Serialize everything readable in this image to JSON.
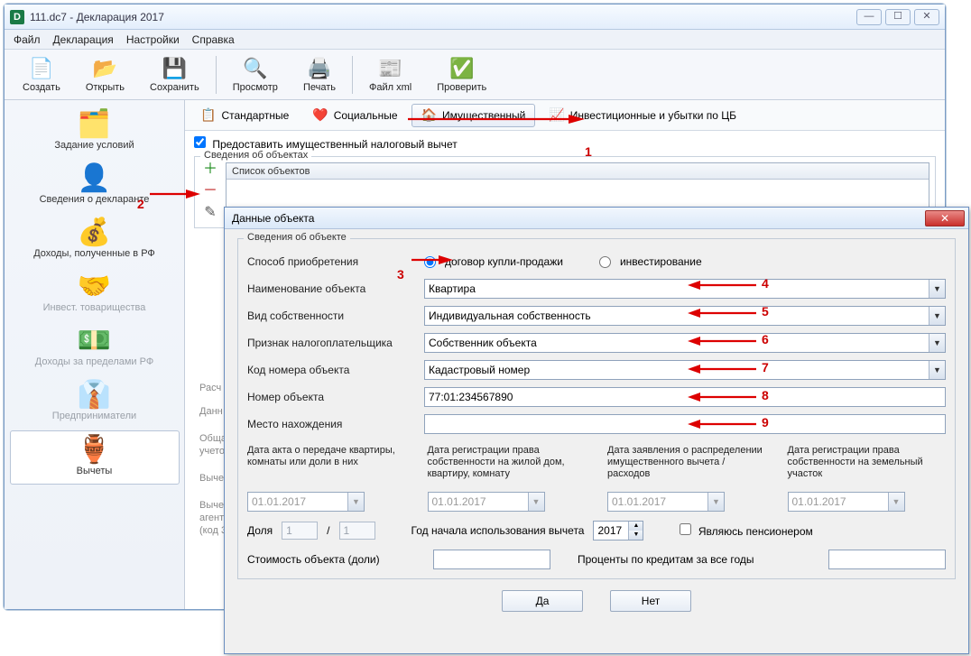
{
  "window": {
    "title": "111.dc7 - Декларация 2017"
  },
  "menu": [
    "Файл",
    "Декларация",
    "Настройки",
    "Справка"
  ],
  "toolbar": [
    {
      "icon": "📄",
      "label": "Создать"
    },
    {
      "icon": "📂",
      "label": "Открыть"
    },
    {
      "icon": "💾",
      "label": "Сохранить"
    },
    {
      "sep": true
    },
    {
      "icon": "🔍",
      "label": "Просмотр"
    },
    {
      "icon": "🖨️",
      "label": "Печать"
    },
    {
      "sep": true
    },
    {
      "icon": "📰",
      "label": "Файл xml"
    },
    {
      "icon": "✅",
      "label": "Проверить"
    }
  ],
  "sidebar": [
    {
      "icon": "🗂️",
      "label": "Задание условий",
      "state": ""
    },
    {
      "icon": "👤",
      "label": "Сведения о декларанте",
      "state": ""
    },
    {
      "icon": "💰",
      "label": "Доходы, полученные в РФ",
      "state": ""
    },
    {
      "icon": "🤝",
      "label": "Инвест. товарищества",
      "state": "disabled"
    },
    {
      "icon": "💵",
      "label": "Доходы за пределами РФ",
      "state": "disabled"
    },
    {
      "icon": "👔",
      "label": "Предприниматели",
      "state": "disabled"
    },
    {
      "icon": "🏺",
      "label": "Вычеты",
      "state": "sel"
    }
  ],
  "dedtabs": [
    {
      "icon": "📋",
      "label": "Стандартные",
      "sel": false
    },
    {
      "icon": "❤️",
      "label": "Социальные",
      "sel": false
    },
    {
      "icon": "🏠",
      "label": "Имущественный",
      "sel": true
    },
    {
      "icon": "📈",
      "label": "Инвестиционные и убытки по ЦБ",
      "sel": false
    }
  ],
  "grant_checkbox": "Предоставить имущественный налоговый вычет",
  "objects_fieldset": "Сведения об объектах",
  "objects_header": "Список объектов",
  "calc_title": "Расчет имущественного вычета",
  "calc_sub1": "Данные по покупке (строительству) объектов",
  "calc_line1a": "Общая стоимость всех объектов (с учетом ограничений вычета)",
  "calc_line2a": "Вычет по предыдущим годам",
  "calc_line3a": "Вычет у налогового агента в отчетном году",
  "faded": {
    "a": "Расч",
    "b": "Данн",
    "c": "Обща\nучето",
    "d": "Выче",
    "e": "Выче\nагент\n(код 3"
  },
  "dialog": {
    "title": "Данные объекта",
    "fieldset": "Сведения об объекте",
    "acq_label": "Способ приобретения",
    "acq_opt1": "договор купли-продажи",
    "acq_opt2": "инвестирование",
    "name_label": "Наименование объекта",
    "name_value": "Квартира",
    "own_label": "Вид собственности",
    "own_value": "Индивидуальная собственность",
    "taxp_label": "Признак налогоплательщика",
    "taxp_value": "Собственник объекта",
    "code_label": "Код номера объекта",
    "code_value": "Кадастровый номер",
    "num_label": "Номер объекта",
    "num_value": "77:01:234567890",
    "loc_label": "Место нахождения",
    "loc_value": "",
    "dates": [
      "Дата акта о передаче квартиры, комнаты или доли в них",
      "Дата регистрации права собственности на жилой дом, квартиру, комнату",
      "Дата заявления о распределении имущественного вычета / расходов",
      "Дата регистрации права собственности на земельный участок"
    ],
    "date_value": "01.01.2017",
    "share_label": "Доля",
    "share_a": "1",
    "share_b": "1",
    "year_label": "Год начала использования вычета",
    "year_value": "2017",
    "pension": "Являюсь пенсионером",
    "cost_label": "Стоимость объекта (доли)",
    "interest_label": "Проценты по кредитам за все годы",
    "ok": "Да",
    "cancel": "Нет"
  },
  "annotations": [
    "1",
    "2",
    "3",
    "4",
    "5",
    "6",
    "7",
    "8",
    "9"
  ]
}
